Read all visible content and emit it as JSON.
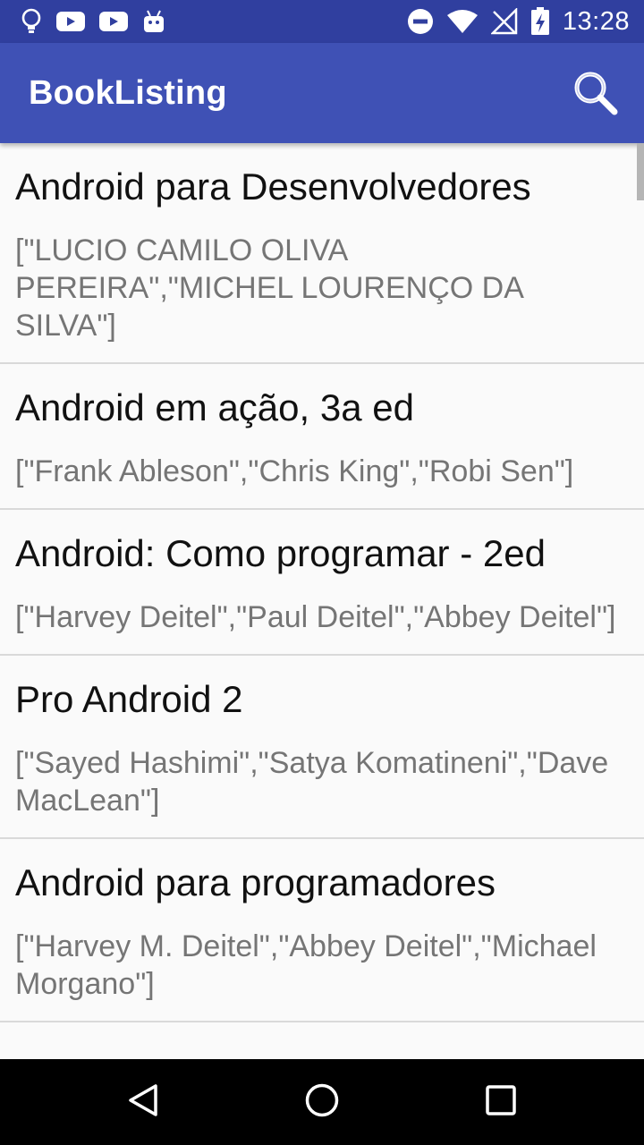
{
  "status_bar": {
    "time": "13:28",
    "left_icons": [
      "lightbulb-icon",
      "youtube-icon",
      "youtube-icon",
      "android-icon"
    ],
    "right_icons": [
      "do-not-disturb-icon",
      "wifi-icon",
      "no-signal-icon",
      "battery-charging-icon"
    ]
  },
  "app_bar": {
    "title": "BookListing",
    "search_icon": "search-icon",
    "color": "#3f51b5",
    "status_color": "#303f9f"
  },
  "books": [
    {
      "title": "Android para Desenvolvedores",
      "authors": "[\"LUCIO CAMILO OLIVA PEREIRA\",\"MICHEL LOURENÇO DA SILVA\"]"
    },
    {
      "title": "Android em ação, 3a ed",
      "authors": "[\"Frank Ableson\",\"Chris King\",\"Robi Sen\"]"
    },
    {
      "title": "Android: Como programar - 2ed",
      "authors": "[\"Harvey Deitel\",\"Paul Deitel\",\"Abbey Deitel\"]"
    },
    {
      "title": "Pro Android 2",
      "authors": "[\"Sayed Hashimi\",\"Satya Komatineni\",\"Dave MacLean\"]"
    },
    {
      "title": "Android para programadores",
      "authors": "[\"Harvey M. Deitel\",\"Abbey Deitel\",\"Michael Morgano\"]"
    },
    {
      "title": "",
      "authors": ""
    }
  ],
  "nav_bar": {
    "back_icon": "back-triangle-icon",
    "home_icon": "home-circle-icon",
    "recents_icon": "recents-square-icon"
  }
}
